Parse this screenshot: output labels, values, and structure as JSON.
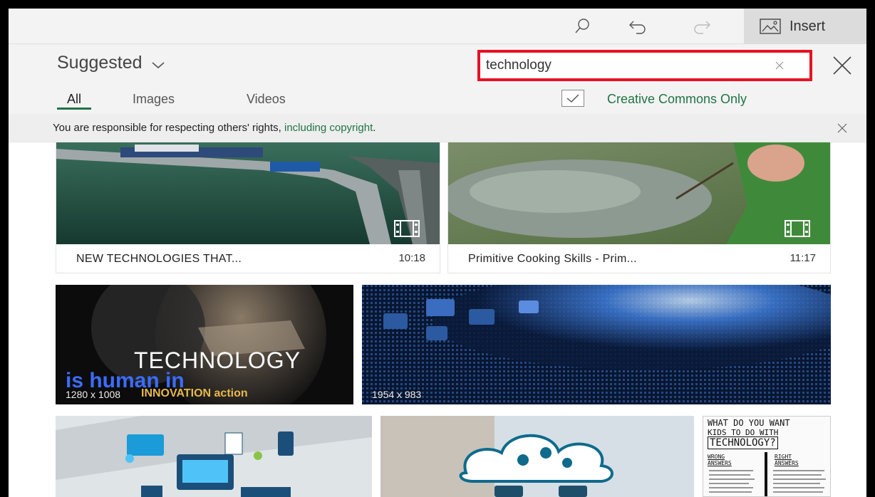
{
  "toolbar": {
    "insert_label": "Insert"
  },
  "header": {
    "source_label": "Suggested",
    "search_value": "technology"
  },
  "tabs": [
    {
      "label": "All",
      "active": true
    },
    {
      "label": "Images",
      "active": false
    },
    {
      "label": "Videos",
      "active": false
    }
  ],
  "filter": {
    "creative_commons_label": "Creative Commons Only",
    "checked": true
  },
  "notice": {
    "text": "You are responsible for respecting others' rights, ",
    "link_text": "including copyright",
    "suffix": "."
  },
  "videos": [
    {
      "title": "NEW TECHNOLOGIES THAT...",
      "duration": "10:18"
    },
    {
      "title": "Primitive Cooking Skills - Prim...",
      "duration": "11:17"
    }
  ],
  "images": [
    {
      "dimensions": "1280 x 1008",
      "caption_top": "TECHNOLOGY",
      "caption_mid": "is human in",
      "caption_bottom": "INNOVATION action"
    },
    {
      "dimensions": "1954 x 983"
    }
  ],
  "handwritten_tile": {
    "line1": "WHAT DO YOU WANT",
    "line2": "KIDS TO DO WITH",
    "line3": "TECHNOLOGY?",
    "col_left": "WRONG ANSWERS",
    "col_right": "RIGHT ANSWERS"
  },
  "colors": {
    "accent_green": "#217346",
    "highlight_red": "#e81123"
  }
}
